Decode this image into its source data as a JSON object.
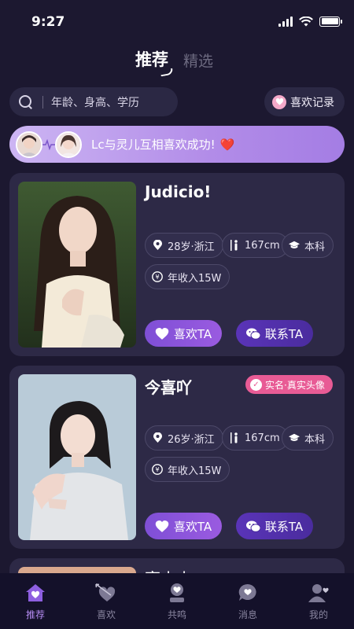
{
  "status_bar": {
    "time": "9:27"
  },
  "tabs": {
    "active": "推荐",
    "inactive": "精选"
  },
  "search": {
    "placeholder": "年龄、身高、学历"
  },
  "like_record": {
    "label": "喜欢记录"
  },
  "match_banner": {
    "text": "Lc与灵儿互相喜欢成功!",
    "emoji": "❤️"
  },
  "cards": [
    {
      "name": "Judicio!",
      "verified": "",
      "age_region": "28岁·浙江",
      "height": "167cm",
      "education": "本科",
      "income": "年收入15W",
      "like_label": "喜欢TA",
      "contact_label": "联系TA"
    },
    {
      "name": "今喜吖",
      "verified": "实名·真实头像",
      "age_region": "26岁·浙江",
      "height": "167cm",
      "education": "本科",
      "income": "年收入15W",
      "like_label": "喜欢TA",
      "contact_label": "联系TA"
    },
    {
      "name": "亭小小"
    }
  ],
  "tabbar": {
    "items": [
      {
        "label": "推荐",
        "icon": "home-heart-icon",
        "active": true
      },
      {
        "label": "喜欢",
        "icon": "arrow-heart-icon",
        "active": false
      },
      {
        "label": "共鸣",
        "icon": "resonance-icon",
        "active": false
      },
      {
        "label": "消息",
        "icon": "message-icon",
        "active": false
      },
      {
        "label": "我的",
        "icon": "profile-icon",
        "active": false
      }
    ]
  },
  "colors": {
    "background": "#1c1830",
    "card": "#2d2946",
    "accent_purple": "#9a5be0",
    "verified_pink": "#e85b95",
    "banner_gradient_start": "#ccb5f3"
  }
}
